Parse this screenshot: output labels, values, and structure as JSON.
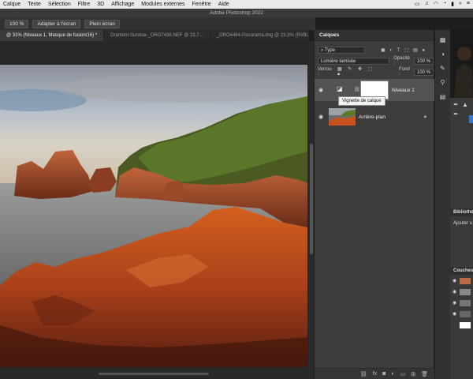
{
  "menubar": {
    "items": [
      "Calque",
      "Texte",
      "Sélection",
      "Filtre",
      "3D",
      "Affichage",
      "Modules externes",
      "Fenêtre",
      "Aide"
    ]
  },
  "window": {
    "title": "Adobe Photoshop 2022"
  },
  "options_bar": {
    "zoom": "100 %",
    "fit_screen": "Adapter à l'écran",
    "full_screen": "Plein écran"
  },
  "doc_tabs": [
    {
      "label": "@ 31% (Niveaux 1, Masque de fusion/16) *",
      "active": true
    },
    {
      "label": "Dramont-Sunrise-_ORO7436.NEF @ 23,7...",
      "active": false
    },
    {
      "label": "_ORO4464-Panorama.dng @ 23,3% (RVB/...",
      "active": false
    }
  ],
  "layers_panel": {
    "title": "Calques",
    "filter_type": "Type",
    "blend_mode": "Lumière tamisée",
    "opacity_label": "Opacité :",
    "opacity_value": "100 %",
    "lock_label": "Verrou :",
    "fill_label": "Fond :",
    "fill_value": "100 %",
    "layers": [
      {
        "name": "Niveaux 1",
        "selected": true,
        "visible": true
      },
      {
        "name": "Arrière-plan",
        "selected": false,
        "visible": true,
        "locked": true
      }
    ],
    "tooltip": "Vignette de calque",
    "footer_icons": [
      "link-icon",
      "fx-icon",
      "mask-icon",
      "adjustment-icon",
      "group-icon",
      "new-layer-icon",
      "trash-icon"
    ],
    "footer_fx": "fx"
  },
  "right_panels": {
    "bibliotheques_label": "Bibliothè",
    "ajouter_label": "Ajouter u",
    "couches_label": "Couches"
  },
  "colors": {
    "accent_blue": "#2f7ad8",
    "rock_orange": "#c8511e"
  }
}
